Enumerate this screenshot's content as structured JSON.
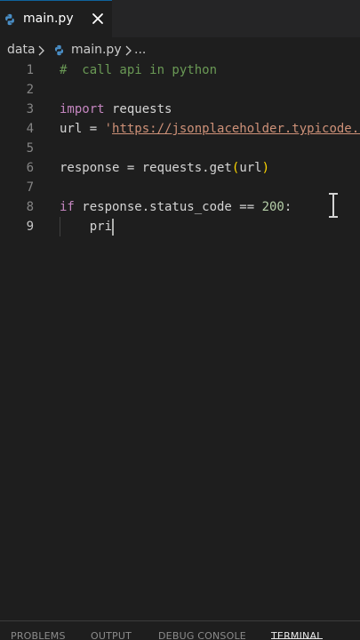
{
  "tab": {
    "filename": "main.py",
    "icon": "python-icon",
    "close_icon": "close-icon"
  },
  "breadcrumb": {
    "folder": "data",
    "file": "main.py",
    "more": "..."
  },
  "editor": {
    "lines": [
      {
        "number": "1",
        "tokens": [
          {
            "text": "#  call api in python",
            "kind": "comment"
          }
        ]
      },
      {
        "number": "2",
        "tokens": []
      },
      {
        "number": "3",
        "tokens": [
          {
            "text": "import",
            "kind": "keyword"
          },
          {
            "text": " requests",
            "kind": "default"
          }
        ]
      },
      {
        "number": "4",
        "tokens": [
          {
            "text": "url = ",
            "kind": "default"
          },
          {
            "text": "'",
            "kind": "string"
          },
          {
            "text": "https://jsonplaceholder.typicode.com",
            "kind": "string_url"
          }
        ]
      },
      {
        "number": "5",
        "tokens": []
      },
      {
        "number": "6",
        "tokens": [
          {
            "text": "response = requests.get",
            "kind": "default"
          },
          {
            "text": "(",
            "kind": "paren"
          },
          {
            "text": "url",
            "kind": "default"
          },
          {
            "text": ")",
            "kind": "paren"
          }
        ]
      },
      {
        "number": "7",
        "tokens": []
      },
      {
        "number": "8",
        "tokens": [
          {
            "text": "if",
            "kind": "keyword"
          },
          {
            "text": " response.status_code == ",
            "kind": "default"
          },
          {
            "text": "200",
            "kind": "number"
          },
          {
            "text": ":",
            "kind": "default"
          }
        ]
      },
      {
        "number": "9",
        "tokens": [
          {
            "text": "    pri",
            "kind": "default"
          }
        ]
      }
    ],
    "active_line": "9"
  },
  "panel": {
    "tabs": [
      {
        "label": "PROBLEMS",
        "active": false
      },
      {
        "label": "OUTPUT",
        "active": false
      },
      {
        "label": "DEBUG CONSOLE",
        "active": false
      },
      {
        "label": "TERMINAL",
        "active": true
      }
    ]
  },
  "colors": {
    "background": "#1e1e1e",
    "tabbar": "#252526",
    "comment": "#6a9955",
    "keyword": "#c586c0",
    "string": "#ce9178",
    "number": "#b5cea8",
    "paren": "#ffd700",
    "python_blue": "#4a8fc7"
  }
}
